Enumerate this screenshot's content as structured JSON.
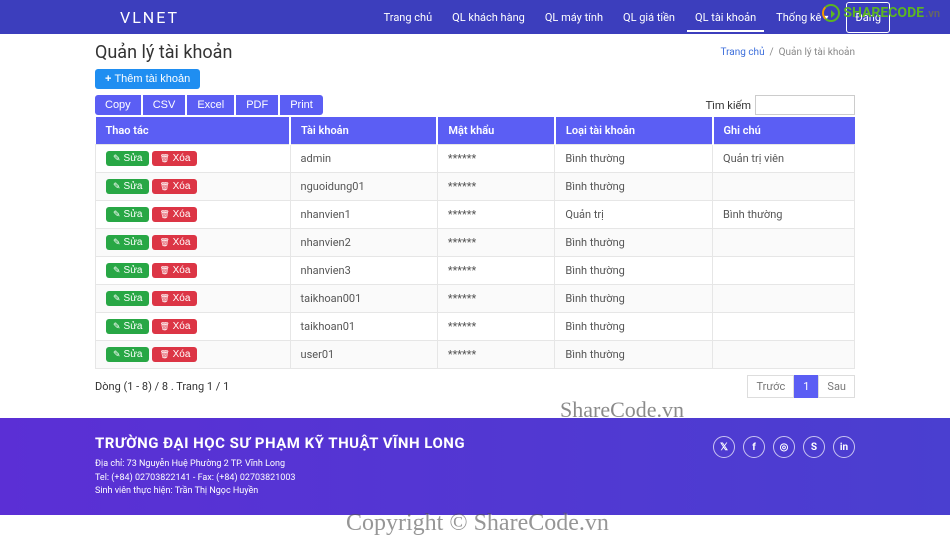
{
  "brand": "VLNET",
  "nav": {
    "items": [
      {
        "label": "Trang chủ"
      },
      {
        "label": "QL khách hàng"
      },
      {
        "label": "QL máy tính"
      },
      {
        "label": "QL giá tiền"
      },
      {
        "label": "QL tài khoản"
      },
      {
        "label": "Thống kê"
      }
    ],
    "login": "Đăng"
  },
  "watermark_brand": {
    "main": "SHARECODE",
    "suffix": ".vn"
  },
  "page": {
    "title": "Quản lý tài khoản",
    "breadcrumb_home": "Trang chủ",
    "breadcrumb_sep": "/",
    "breadcrumb_current": "Quản lý tài khoản"
  },
  "buttons": {
    "add": "Thêm tài khoản",
    "copy": "Copy",
    "csv": "CSV",
    "excel": "Excel",
    "pdf": "PDF",
    "print": "Print",
    "edit": "Sửa",
    "delete": "Xóa"
  },
  "search": {
    "label": "Tìm kiếm",
    "value": ""
  },
  "table": {
    "headers": [
      "Thao tác",
      "Tài khoản",
      "Mật khẩu",
      "Loại tài khoản",
      "Ghi chú"
    ],
    "rows": [
      {
        "user": "admin",
        "pass": "******",
        "type": "Bình thường",
        "note": "Quản trị viên"
      },
      {
        "user": "nguoidung01",
        "pass": "******",
        "type": "Bình thường",
        "note": ""
      },
      {
        "user": "nhanvien1",
        "pass": "******",
        "type": "Quản trị",
        "note": "Bình thường"
      },
      {
        "user": "nhanvien2",
        "pass": "******",
        "type": "Bình thường",
        "note": ""
      },
      {
        "user": "nhanvien3",
        "pass": "******",
        "type": "Bình thường",
        "note": ""
      },
      {
        "user": "taikhoan001",
        "pass": "******",
        "type": "Bình thường",
        "note": ""
      },
      {
        "user": "taikhoan01",
        "pass": "******",
        "type": "Bình thường",
        "note": ""
      },
      {
        "user": "user01",
        "pass": "******",
        "type": "Bình thường",
        "note": ""
      }
    ],
    "info": "Dòng (1 - 8) / 8 . Trang 1 / 1",
    "pagination": {
      "prev": "Trước",
      "pages": [
        "1"
      ],
      "next": "Sau"
    }
  },
  "footer": {
    "title": "TRƯỜNG ĐẠI HỌC SƯ PHẠM KỸ THUẬT VĨNH LONG",
    "addr": "Địa chỉ: 73 Nguyễn Huệ Phường 2 TP. Vĩnh Long",
    "tel": "Tel: (+84) 02703822141 - Fax: (+84) 02703821003",
    "author": "Sinh viên thực hiện: Trần Thị Ngọc Huyền"
  },
  "overlay": {
    "wm1": "ShareCode.vn",
    "wm2": "Copyright © ShareCode.vn"
  }
}
